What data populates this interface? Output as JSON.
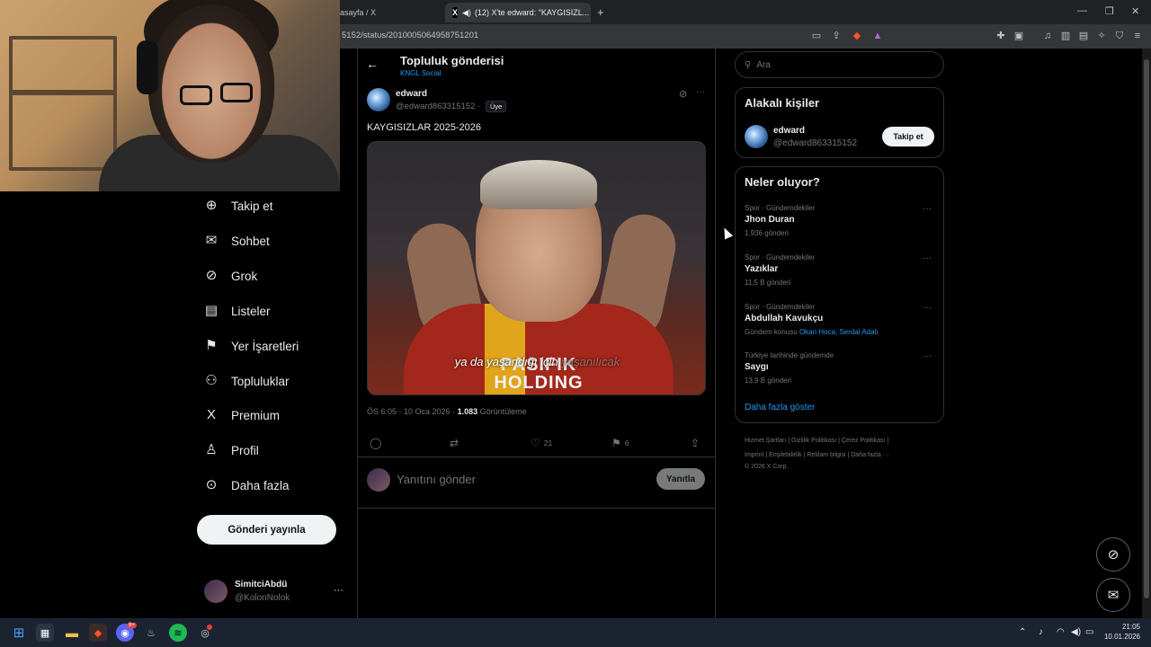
{
  "browser": {
    "tabs": [
      {
        "label": "asayfa / X",
        "active": false
      },
      {
        "label": "(12) X'te edward: \"KAYGISIZL...",
        "active": true
      }
    ],
    "new_tab": "+",
    "url": "5152/status/2010005064958751201",
    "window_controls": {
      "minimize": "—",
      "restore": "❐",
      "close": "✕"
    }
  },
  "nav": {
    "items": [
      {
        "label": "Takip et",
        "icon": "person-add-icon",
        "glyph": "⊕"
      },
      {
        "label": "Sohbet",
        "icon": "mail-icon",
        "glyph": "✉"
      },
      {
        "label": "Grok",
        "icon": "grok-icon",
        "glyph": "⊘"
      },
      {
        "label": "Listeler",
        "icon": "list-icon",
        "glyph": "▤"
      },
      {
        "label": "Yer İşaretleri",
        "icon": "bookmark-icon",
        "glyph": "⚑"
      },
      {
        "label": "Topluluklar",
        "icon": "communities-icon",
        "glyph": "⚇"
      },
      {
        "label": "Premium",
        "icon": "x-logo-icon",
        "glyph": "X"
      },
      {
        "label": "Profil",
        "icon": "profile-icon",
        "glyph": "♙"
      },
      {
        "label": "Daha fazla",
        "icon": "more-circle-icon",
        "glyph": "⊙"
      }
    ],
    "post_button": "Gönderi yayınla",
    "account": {
      "name": "SimitciAbdü",
      "handle": "@KolonNolok",
      "more": "···"
    }
  },
  "post": {
    "header_title": "Topluluk gönderisi",
    "header_subtitle": "KNGL Social",
    "author_name": "edward",
    "author_handle": "@edward863315152 ·",
    "member_badge": "Üye",
    "text": "KAYGISIZLAR 2025-2026",
    "media_caption": "ya da yaşandığı için",
    "media_caption_faded": " yaşanılıcak",
    "media_sponsor": "PASIFIK HOLDING",
    "timestamp": "ÖS 6:05 · 10 Oca 2026 ·",
    "views_count": "1.083",
    "views_label": " Görüntüleme",
    "likes": "21",
    "bookmarks": "6",
    "reply_placeholder": "Yanıtını gönder",
    "reply_button": "Yanıtla"
  },
  "sidebar": {
    "search_placeholder": "Ara",
    "related_title": "Alakalı kişiler",
    "related_name": "edward",
    "related_handle": "@edward863315152",
    "follow_button": "Takip et",
    "trends_title": "Neler oluyor?",
    "trends": [
      {
        "category": "Spor · Gündemdekiler",
        "name": "Jhon Duran",
        "count": "1.936 gönderi"
      },
      {
        "category": "Spor · Gündemdekiler",
        "name": "Yazıklar",
        "count": "11,5 B gönderi"
      },
      {
        "category": "Spor · Gündemdekiler",
        "name": "Abdullah Kavukçu",
        "count_prefix": "Gündem konusu ",
        "links": "Okan Hoca, Serdal Adalı"
      },
      {
        "category": "Türkiye tarihinde gündemde",
        "name": "Saygı",
        "count": "13,9 B gönderi"
      }
    ],
    "show_more": "Daha fazla göster",
    "footer_line1": "Hizmet Şartları  |  Gizlilik Politikası  |  Çerez Politikası  |",
    "footer_line2": "Imprint  |  Erişilebilirlik  |  Reklam bilgisi  |  Daha fazla ···",
    "footer_line3": "© 2026 X Corp."
  },
  "taskbar": {
    "time": "21:05",
    "date": "10.01.2026",
    "discord_badge": "9+"
  },
  "colors": {
    "accent": "#1d9bf0",
    "background": "#000000",
    "border": "#2f3336",
    "muted": "#71767b"
  }
}
